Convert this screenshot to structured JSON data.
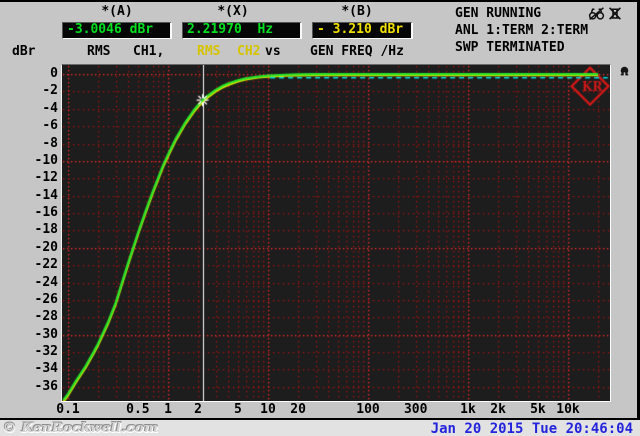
{
  "header": {
    "a_label": "*(A)",
    "a_value": "-3.0046 dBr",
    "x_label": "*(X)",
    "x_value": "2.21970  Hz",
    "b_label": "*(B)",
    "b_value": "- 3.210 dBr"
  },
  "legend": {
    "unit": "dBr",
    "ch1_meas": "RMS",
    "ch1_name": "CH1,",
    "ch2_meas": "RMS",
    "ch2_name": "CH2",
    "vs": "vs",
    "x_name": "GEN FREQ /Hz"
  },
  "status": {
    "gen": "GEN RUNNING",
    "anl": "ANL 1:TERM 2:TERM",
    "swp": "SWP TERMINATED"
  },
  "footer": {
    "watermark": "© KenRockwell.com",
    "datetime": "Jan 20 2015 Tue 20:46:04"
  },
  "logo_text": "KR",
  "chart_data": {
    "type": "line",
    "x_scale": "log",
    "xlabel": "GEN FREQ /Hz",
    "ylabel": "dBr",
    "xlim": [
      0.0871,
      26300
    ],
    "ylim": [
      -37.63,
      1.04
    ],
    "x_ticks": [
      {
        "f": 0.1,
        "label": "0.1"
      },
      {
        "f": 0.5,
        "label": "0.5"
      },
      {
        "f": 1,
        "label": "1"
      },
      {
        "f": 2,
        "label": "2"
      },
      {
        "f": 5,
        "label": "5"
      },
      {
        "f": 10,
        "label": "10"
      },
      {
        "f": 20,
        "label": "20"
      },
      {
        "f": 100,
        "label": "100"
      },
      {
        "f": 300,
        "label": "300"
      },
      {
        "f": 1000,
        "label": "1k"
      },
      {
        "f": 2000,
        "label": "2k"
      },
      {
        "f": 5000,
        "label": "5k"
      },
      {
        "f": 10000,
        "label": "10k"
      }
    ],
    "y_ticks": [
      0,
      -2,
      -4,
      -6,
      -8,
      -10,
      -12,
      -14,
      -16,
      -18,
      -20,
      -22,
      -24,
      -26,
      -28,
      -30,
      -32,
      -34,
      -36
    ],
    "grid": {
      "minor_color": "#a81111",
      "major_color": "#ff2d2d"
    },
    "cursor": {
      "f": 2.2197,
      "db": -3.0046,
      "color": "#ffffff"
    },
    "logo": {
      "f": 16600,
      "db": -1.4,
      "color": "#d01818"
    },
    "series": [
      {
        "name": "RMS CH2",
        "color": "#e8e800",
        "width": 2.2,
        "dash": [],
        "points": [
          [
            0.09,
            -37.7
          ],
          [
            0.1,
            -37.0
          ],
          [
            0.12,
            -35.5
          ],
          [
            0.15,
            -33.8
          ],
          [
            0.18,
            -32.2
          ],
          [
            0.2,
            -31.2
          ],
          [
            0.25,
            -28.8
          ],
          [
            0.3,
            -26.5
          ],
          [
            0.4,
            -21.9
          ],
          [
            0.5,
            -18.5
          ],
          [
            0.6,
            -15.9
          ],
          [
            0.7,
            -13.8
          ],
          [
            0.8,
            -12.1
          ],
          [
            0.9,
            -10.6
          ],
          [
            1.0,
            -9.46
          ],
          [
            1.2,
            -7.6
          ],
          [
            1.5,
            -5.7
          ],
          [
            1.8,
            -4.4
          ],
          [
            2.0,
            -3.78
          ],
          [
            2.2197,
            -3.21
          ],
          [
            2.5,
            -2.69
          ],
          [
            3,
            -2.0
          ],
          [
            3.5,
            -1.55
          ],
          [
            4,
            -1.25
          ],
          [
            5,
            -0.85
          ],
          [
            6,
            -0.62
          ],
          [
            8,
            -0.4
          ],
          [
            10,
            -0.29
          ],
          [
            15,
            -0.18
          ],
          [
            20,
            -0.15
          ],
          [
            30,
            -0.13
          ],
          [
            50,
            -0.12
          ],
          [
            100,
            -0.12
          ],
          [
            300,
            -0.12
          ],
          [
            1000,
            -0.12
          ],
          [
            3000,
            -0.12
          ],
          [
            10000,
            -0.12
          ],
          [
            20000,
            -0.14
          ]
        ]
      },
      {
        "name": "RMS CH1",
        "color": "#28e428",
        "width": 2.2,
        "dash": [],
        "points": [
          [
            0.09,
            -37.5
          ],
          [
            0.1,
            -36.8
          ],
          [
            0.12,
            -35.3
          ],
          [
            0.15,
            -33.6
          ],
          [
            0.18,
            -32.0
          ],
          [
            0.2,
            -31.0
          ],
          [
            0.25,
            -28.6
          ],
          [
            0.3,
            -26.3
          ],
          [
            0.4,
            -21.7
          ],
          [
            0.5,
            -18.3
          ],
          [
            0.6,
            -15.7
          ],
          [
            0.7,
            -13.6
          ],
          [
            0.8,
            -11.9
          ],
          [
            0.9,
            -10.4
          ],
          [
            1.0,
            -9.25
          ],
          [
            1.2,
            -7.4
          ],
          [
            1.5,
            -5.5
          ],
          [
            1.8,
            -4.2
          ],
          [
            2.0,
            -3.57
          ],
          [
            2.2197,
            -3.0
          ],
          [
            2.5,
            -2.48
          ],
          [
            3,
            -1.82
          ],
          [
            3.5,
            -1.38
          ],
          [
            4,
            -1.08
          ],
          [
            5,
            -0.71
          ],
          [
            6,
            -0.5
          ],
          [
            8,
            -0.29
          ],
          [
            10,
            -0.19
          ],
          [
            15,
            -0.08
          ],
          [
            20,
            -0.05
          ],
          [
            30,
            -0.02
          ],
          [
            50,
            -0.01
          ],
          [
            100,
            0
          ],
          [
            300,
            0
          ],
          [
            1000,
            0
          ],
          [
            3000,
            0
          ],
          [
            10000,
            0
          ],
          [
            20000,
            -0.02
          ]
        ]
      },
      {
        "name": "REF",
        "color": "#00dcdc",
        "width": 1.6,
        "dash": [
          5,
          4
        ],
        "points": [
          [
            10.5,
            -0.42
          ],
          [
            25000,
            -0.42
          ]
        ]
      }
    ]
  }
}
